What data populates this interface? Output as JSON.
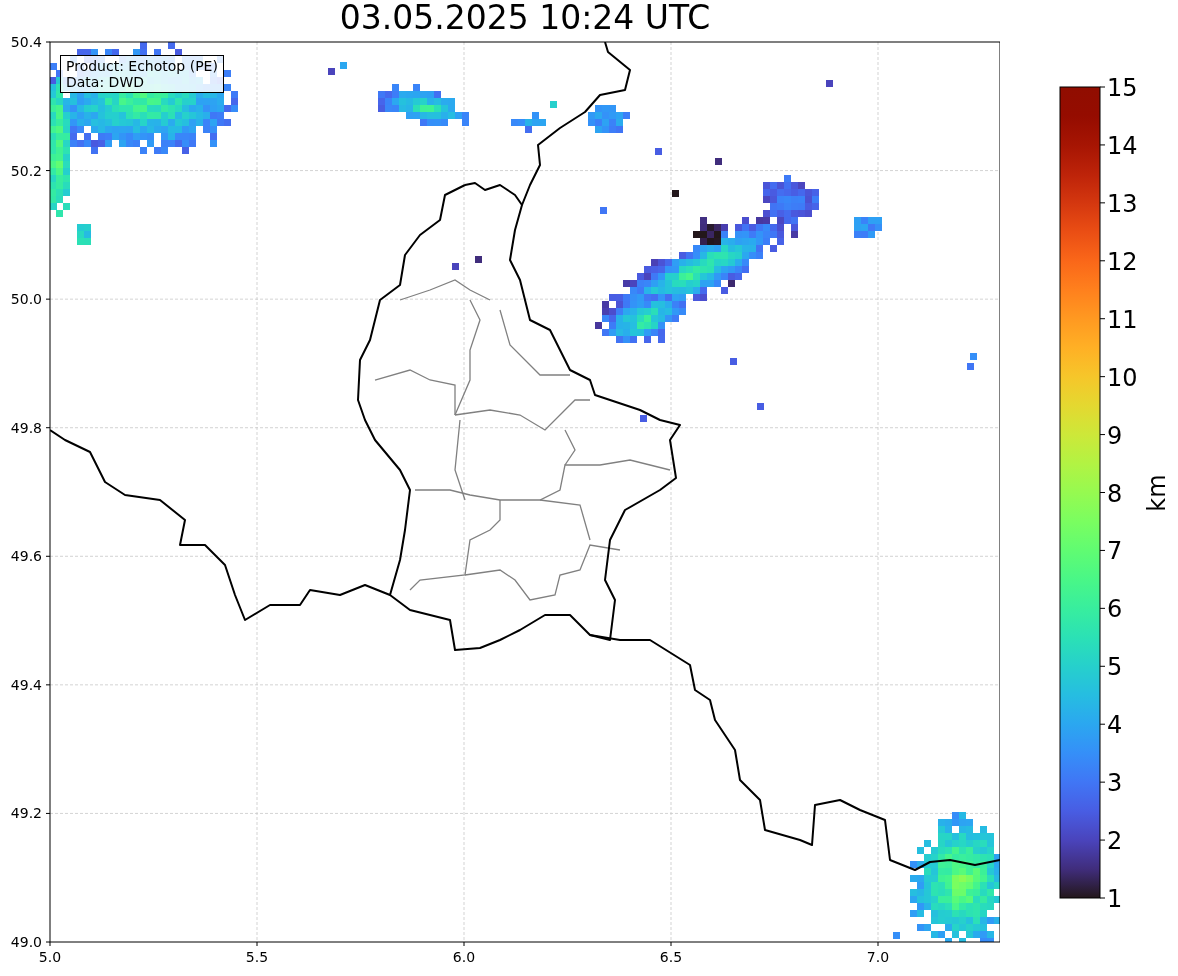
{
  "figure": {
    "title": "03.05.2025 10:24 UTC"
  },
  "map": {
    "info_lines": [
      "Product: Echotop (PE)",
      "Data: DWD"
    ],
    "x_ticks": [
      "5.0",
      "5.5",
      "6.0",
      "6.5",
      "7.0"
    ],
    "y_ticks": [
      "50.4",
      "50.2",
      "50.0",
      "49.8",
      "49.6",
      "49.4",
      "49.2",
      "49.0"
    ]
  },
  "colorbar": {
    "label": "km",
    "ticks": [
      "15",
      "14",
      "13",
      "12",
      "11",
      "10",
      "9",
      "8",
      "7",
      "6",
      "5",
      "4",
      "3",
      "2",
      "1"
    ]
  }
}
